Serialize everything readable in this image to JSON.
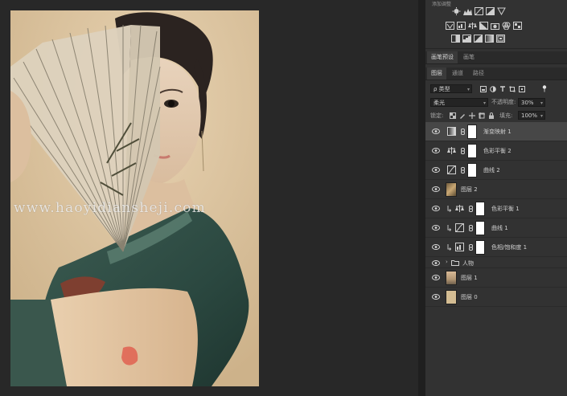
{
  "watermark": "www.haoyidiansheji.com",
  "adjustments": {
    "title": "添加调整",
    "row1": [
      "brightness-contrast-icon",
      "levels-icon",
      "curves-icon",
      "exposure-icon",
      "triangle-down-icon"
    ],
    "row2": [
      "vibrance-icon",
      "hue-saturation-icon",
      "color-balance-icon",
      "black-white-icon",
      "photo-filter-icon",
      "channel-mixer-icon",
      "color-lookup-icon"
    ],
    "row3": [
      "invert-icon",
      "posterize-icon",
      "threshold-icon",
      "gradient-map-icon",
      "selective-color-icon"
    ]
  },
  "top_tabs": [
    "画笔预设",
    "画笔"
  ],
  "layer_tabs": [
    "图层",
    "通道",
    "路径"
  ],
  "filter": {
    "kind": "ρ 类型"
  },
  "blend": {
    "mode": "柔光",
    "opacity_label": "不透明度:",
    "opacity_value": "30%"
  },
  "lock": {
    "label": "锁定:",
    "fill_label": "填充:",
    "fill_value": "100%"
  },
  "layers": [
    {
      "name": "渐变映射 1",
      "selected": true
    },
    {
      "name": "色彩平衡 2"
    },
    {
      "name": "曲线 2"
    },
    {
      "name": "图层 2"
    },
    {
      "name": "色彩平衡 1"
    },
    {
      "name": "曲线 1"
    },
    {
      "name": "色相/饱和度 1"
    },
    {
      "name": "人物"
    },
    {
      "name": "图层 1"
    },
    {
      "name": "图层 0"
    }
  ],
  "colors": {
    "panel": "#323232",
    "selected_row": "#474747",
    "canvas_bg": "#282828"
  }
}
